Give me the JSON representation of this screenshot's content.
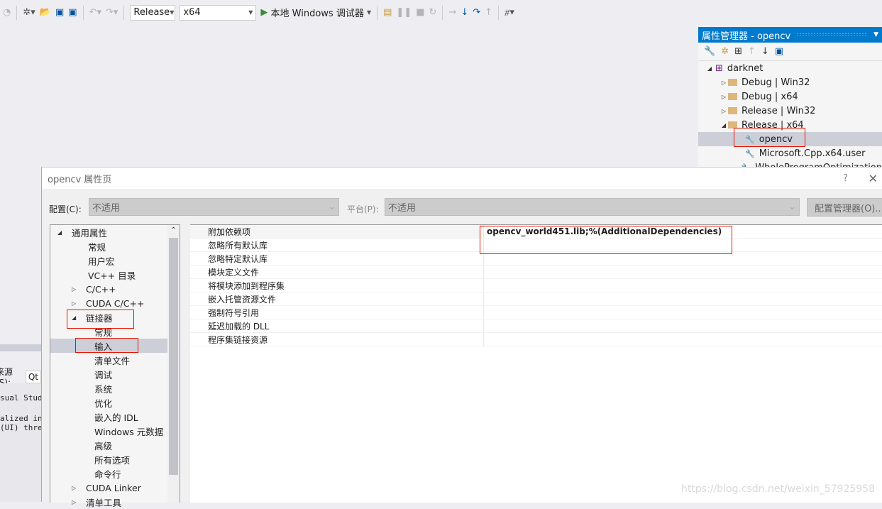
{
  "toolbar": {
    "config": "Release",
    "platform": "x64",
    "run_label": "本地 Windows 调试器",
    "icons": [
      "new-project-icon",
      "open-icon",
      "save-icon",
      "save-all-icon",
      "undo-icon",
      "redo-icon",
      "play-icon",
      "find-icon",
      "pause-icon",
      "stop-icon",
      "restart-icon",
      "show-next-icon",
      "step-into-icon",
      "step-over-icon",
      "step-out-icon",
      "hex-icon"
    ]
  },
  "property_manager": {
    "title": "属性管理器 - opencv",
    "tree": [
      {
        "label": "darknet",
        "level": 0,
        "expand": "open"
      },
      {
        "label": "Debug | Win32",
        "level": 1,
        "expand": "closed"
      },
      {
        "label": "Debug | x64",
        "level": 1,
        "expand": "closed"
      },
      {
        "label": "Release | Win32",
        "level": 1,
        "expand": "closed"
      },
      {
        "label": "Release | x64",
        "level": 1,
        "expand": "open"
      },
      {
        "label": "opencv",
        "level": 2,
        "selected": true
      },
      {
        "label": "Microsoft.Cpp.x64.user",
        "level": 2
      },
      {
        "label": "WholeProgramOptimization",
        "level": 2
      }
    ]
  },
  "background": {
    "source_label": "来源(S):",
    "source_value": "Qt",
    "output_lines": [
      "sual Studi",
      "alized in:",
      "(UI) thres"
    ]
  },
  "dialog": {
    "title": "opencv 属性页",
    "help": "?",
    "close": "✕",
    "config_label": "配置(C):",
    "config_value": "不适用",
    "platform_label": "平台(P):",
    "platform_value": "不适用",
    "config_manager": "配置管理器(O)...",
    "tree": [
      {
        "label": "通用属性",
        "level": 0,
        "expand": "open"
      },
      {
        "label": "常规",
        "level": 1
      },
      {
        "label": "用户宏",
        "level": 1
      },
      {
        "label": "VC++ 目录",
        "level": 1
      },
      {
        "label": "C/C++",
        "level": 1,
        "expand": "closed"
      },
      {
        "label": "CUDA C/C++",
        "level": 1,
        "expand": "closed"
      },
      {
        "label": "链接器",
        "level": 1,
        "expand": "open"
      },
      {
        "label": "常规",
        "level": 2
      },
      {
        "label": "输入",
        "level": 2,
        "selected": true
      },
      {
        "label": "清单文件",
        "level": 2
      },
      {
        "label": "调试",
        "level": 2
      },
      {
        "label": "系统",
        "level": 2
      },
      {
        "label": "优化",
        "level": 2
      },
      {
        "label": "嵌入的 IDL",
        "level": 2
      },
      {
        "label": "Windows 元数据",
        "level": 2
      },
      {
        "label": "高级",
        "level": 2
      },
      {
        "label": "所有选项",
        "level": 2
      },
      {
        "label": "命令行",
        "level": 2
      },
      {
        "label": "CUDA Linker",
        "level": 1,
        "expand": "closed"
      },
      {
        "label": "清单工具",
        "level": 1,
        "expand": "closed"
      }
    ],
    "properties": [
      {
        "name": "附加依赖项",
        "value": "opencv_world451.lib;%(AdditionalDependencies)"
      },
      {
        "name": "忽略所有默认库",
        "value": ""
      },
      {
        "name": "忽略特定默认库",
        "value": ""
      },
      {
        "name": "模块定义文件",
        "value": ""
      },
      {
        "name": "将模块添加到程序集",
        "value": ""
      },
      {
        "name": "嵌入托管资源文件",
        "value": ""
      },
      {
        "name": "强制符号引用",
        "value": ""
      },
      {
        "name": "延迟加载的 DLL",
        "value": ""
      },
      {
        "name": "程序集链接资源",
        "value": ""
      }
    ]
  },
  "watermark": "https://blog.csdn.net/weixin_57925958"
}
